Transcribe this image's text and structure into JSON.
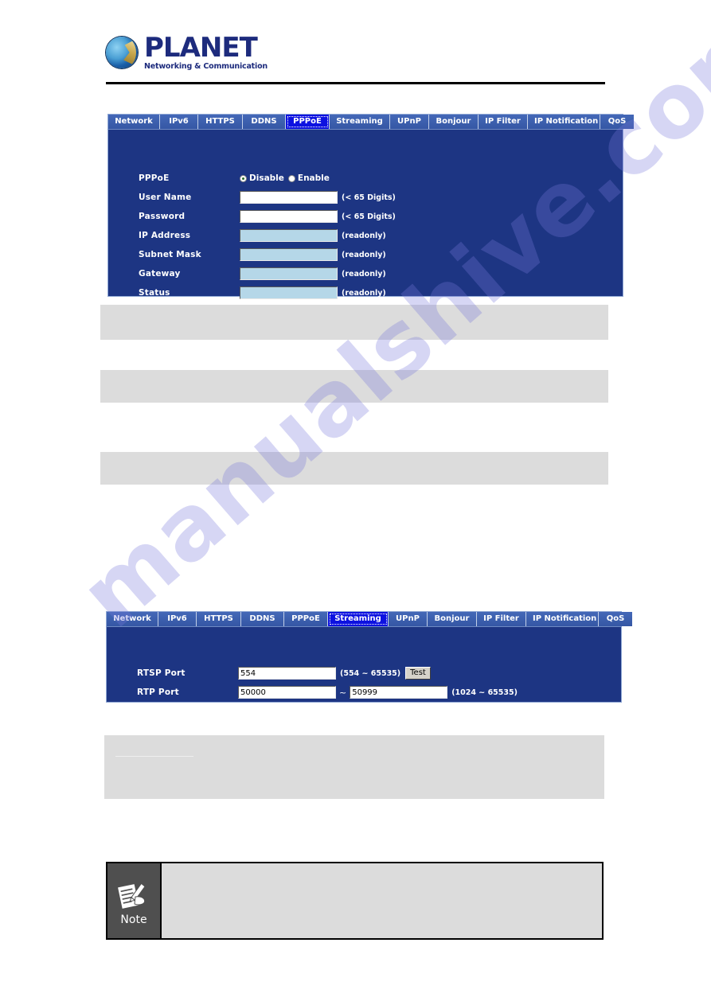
{
  "brand": {
    "name": "PLANET",
    "tagline": "Networking & Communication",
    "logo_icon": "globe-icon"
  },
  "watermark": {
    "text": "manualshive.com"
  },
  "panels": [
    {
      "id": "pppoe",
      "tabs": [
        {
          "label": "Network",
          "active": false
        },
        {
          "label": "IPv6",
          "active": false
        },
        {
          "label": "HTTPS",
          "active": false
        },
        {
          "label": "DDNS",
          "active": false
        },
        {
          "label": "PPPoE",
          "active": true
        },
        {
          "label": "Streaming",
          "active": false
        },
        {
          "label": "UPnP",
          "active": false
        },
        {
          "label": "Bonjour",
          "active": false
        },
        {
          "label": "IP Filter",
          "active": false
        },
        {
          "label": "IP Notification",
          "active": false
        },
        {
          "label": "QoS",
          "active": false
        }
      ],
      "fields": {
        "pppoe_label": "PPPoE",
        "radio_disable": "Disable",
        "radio_enable": "Enable",
        "radio_selected": "Disable",
        "username_label": "User Name",
        "username_value": "",
        "username_hint": "(< 65 Digits)",
        "password_label": "Password",
        "password_value": "",
        "password_hint": "(< 65 Digits)",
        "ip_address_label": "IP Address",
        "ip_address_value": "",
        "ip_address_hint": "(readonly)",
        "subnet_mask_label": "Subnet Mask",
        "subnet_mask_value": "",
        "subnet_mask_hint": "(readonly)",
        "gateway_label": "Gateway",
        "gateway_value": "",
        "gateway_hint": "(readonly)",
        "status_label": "Status",
        "status_value": "",
        "status_hint": "(readonly)"
      }
    },
    {
      "id": "streaming",
      "tabs": [
        {
          "label": "Network",
          "active": false
        },
        {
          "label": "IPv6",
          "active": false
        },
        {
          "label": "HTTPS",
          "active": false
        },
        {
          "label": "DDNS",
          "active": false
        },
        {
          "label": "PPPoE",
          "active": false
        },
        {
          "label": "Streaming",
          "active": true
        },
        {
          "label": "UPnP",
          "active": false
        },
        {
          "label": "Bonjour",
          "active": false
        },
        {
          "label": "IP Filter",
          "active": false
        },
        {
          "label": "IP Notification",
          "active": false
        },
        {
          "label": "QoS",
          "active": false
        }
      ],
      "fields": {
        "rtsp_port_label": "RTSP Port",
        "rtsp_port_value": "554",
        "rtsp_port_hint": "(554 ~ 65535)",
        "test_button": "Test",
        "rtp_port_label": "RTP Port",
        "rtp_port_from": "50000",
        "rtp_port_separator": "~",
        "rtp_port_to": "50999",
        "rtp_port_hint": "(1024 ~ 65535)"
      }
    }
  ],
  "note": {
    "caption": "Note",
    "icon": "note-pencil-icon",
    "body_text": ""
  },
  "colors": {
    "panel_navy": "#1d3583",
    "tabbar_blue": "#3a5fb0",
    "active_tab_blue": "#0d12e0",
    "readonly_field": "#b5d7e8",
    "brand_navy": "#1d2b7d",
    "redacted_gray": "#dcdcdc",
    "note_tab_gray": "#4f4f4f"
  }
}
